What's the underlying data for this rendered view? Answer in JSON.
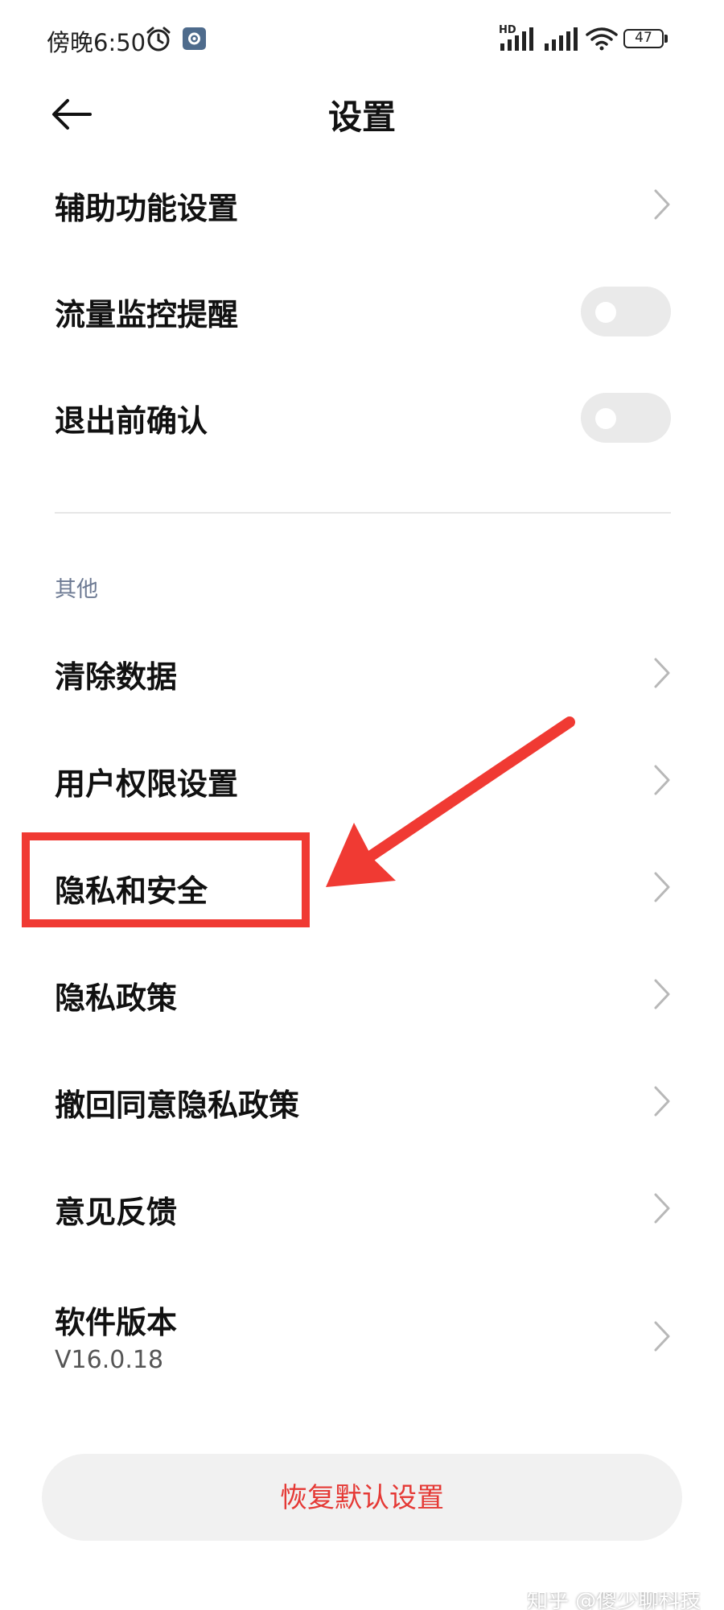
{
  "status_bar": {
    "time": "傍晚6:50",
    "hd_label": "HD",
    "battery": "47"
  },
  "header": {
    "title": "设置"
  },
  "settings": {
    "accessibility": "辅助功能设置",
    "traffic_monitor": "流量监控提醒",
    "exit_confirm": "退出前确认"
  },
  "other_section": {
    "header": "其他",
    "items": [
      {
        "label": "清除数据"
      },
      {
        "label": "用户权限设置"
      },
      {
        "label": "隐私和安全"
      },
      {
        "label": "隐私政策"
      },
      {
        "label": "撤回同意隐私政策"
      },
      {
        "label": "意见反馈"
      },
      {
        "label": "软件版本",
        "sub": "V16.0.18"
      }
    ]
  },
  "reset_button": "恢复默认设置",
  "watermark": "知乎 @傻少聊科技",
  "colors": {
    "highlight": "#f03a33",
    "reset_text": "#e53935",
    "section_header": "#6d7a93"
  }
}
